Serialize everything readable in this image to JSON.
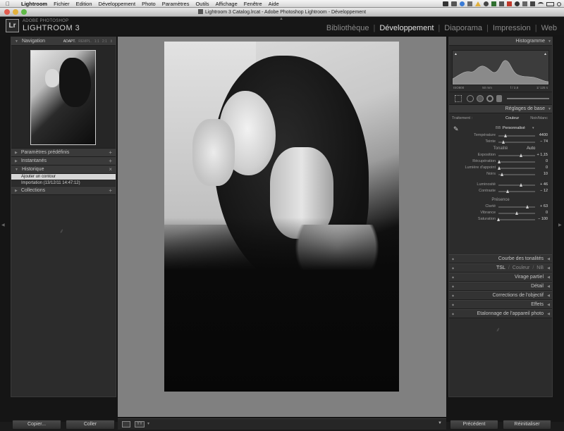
{
  "menubar": {
    "app": "Lightroom",
    "items": [
      "Fichier",
      "Edition",
      "Développement",
      "Photo",
      "Paramètres",
      "Outils",
      "Affichage",
      "Fenêtre",
      "Aide"
    ]
  },
  "window": {
    "title": "Lightroom 3 Catalog.lrcat - Adobe Photoshop Lightroom - Développement"
  },
  "identity": {
    "badge": "Lr",
    "brand_small": "ADOBE PHOTOSHOP",
    "brand_big": "LIGHTROOM 3"
  },
  "modules": [
    "Bibliothèque",
    "Développement",
    "Diaporama",
    "Impression",
    "Web"
  ],
  "left_panel": {
    "navigation": {
      "title": "Navigation",
      "zoom_options": [
        "ADAPT.",
        "REMPL.",
        "1:1",
        "2:1"
      ]
    },
    "presets": "Paramètres prédéfinis",
    "snapshots": "Instantanés",
    "history": {
      "title": "Historique",
      "items": [
        "Ajouter un contour",
        "Importation (13/12/11 14:47:12)"
      ]
    },
    "collections": "Collections",
    "copy_button": "Copier...",
    "paste_button": "Coller"
  },
  "right_panel": {
    "histogram": {
      "title": "Histogramme",
      "iso": "ISO800",
      "focal": "50 mm",
      "aperture": "f / 2,8",
      "shutter": "1/ 125 s"
    },
    "basic": {
      "title": "Réglages de base",
      "treatment_label": "Traitement :",
      "treatment_color": "Couleur",
      "treatment_bw": "Noir/blanc",
      "wb_label": "BB :",
      "wb_value": "Personnalisé",
      "tone_label": "Tonalité",
      "tone_auto": "Auto",
      "presence_label": "Présence",
      "sliders": [
        {
          "label": "Température",
          "value": "4400",
          "pos": 0.2
        },
        {
          "label": "Teinte",
          "value": "− 74",
          "pos": 0.15
        },
        {
          "label": "Exposition",
          "value": "+ 1,15",
          "pos": 0.62
        },
        {
          "label": "Récupération",
          "value": "0",
          "pos": 0.02
        },
        {
          "label": "Lumière d'appoint",
          "value": "0",
          "pos": 0.02
        },
        {
          "label": "Noirs",
          "value": "10",
          "pos": 0.1
        },
        {
          "label": "Luminosité",
          "value": "+ 46",
          "pos": 0.62
        },
        {
          "label": "Contraste",
          "value": "− 12",
          "pos": 0.25
        },
        {
          "label": "Clarté",
          "value": "+ 63",
          "pos": 0.8
        },
        {
          "label": "Vibrance",
          "value": "0",
          "pos": 0.5
        },
        {
          "label": "Saturation",
          "value": "− 100",
          "pos": 0.0
        }
      ]
    },
    "collapsed_panels": [
      "Courbe des tonalités",
      "Virage partiel",
      "Détail",
      "Corrections de l'objectif",
      "Effets",
      "Etalonnage de l'appareil photo"
    ],
    "hsl": {
      "tsl": "TSL",
      "couleur": "Couleur",
      "nb": "NB"
    },
    "previous_button": "Précédent",
    "reset_button": "Réinitialiser"
  },
  "center_toolbar": {
    "loupe_label": "",
    "compare_label": "YY"
  },
  "colors": {
    "close": "#e25c4f",
    "minimize": "#e2b13c",
    "zoom": "#5fba46"
  }
}
